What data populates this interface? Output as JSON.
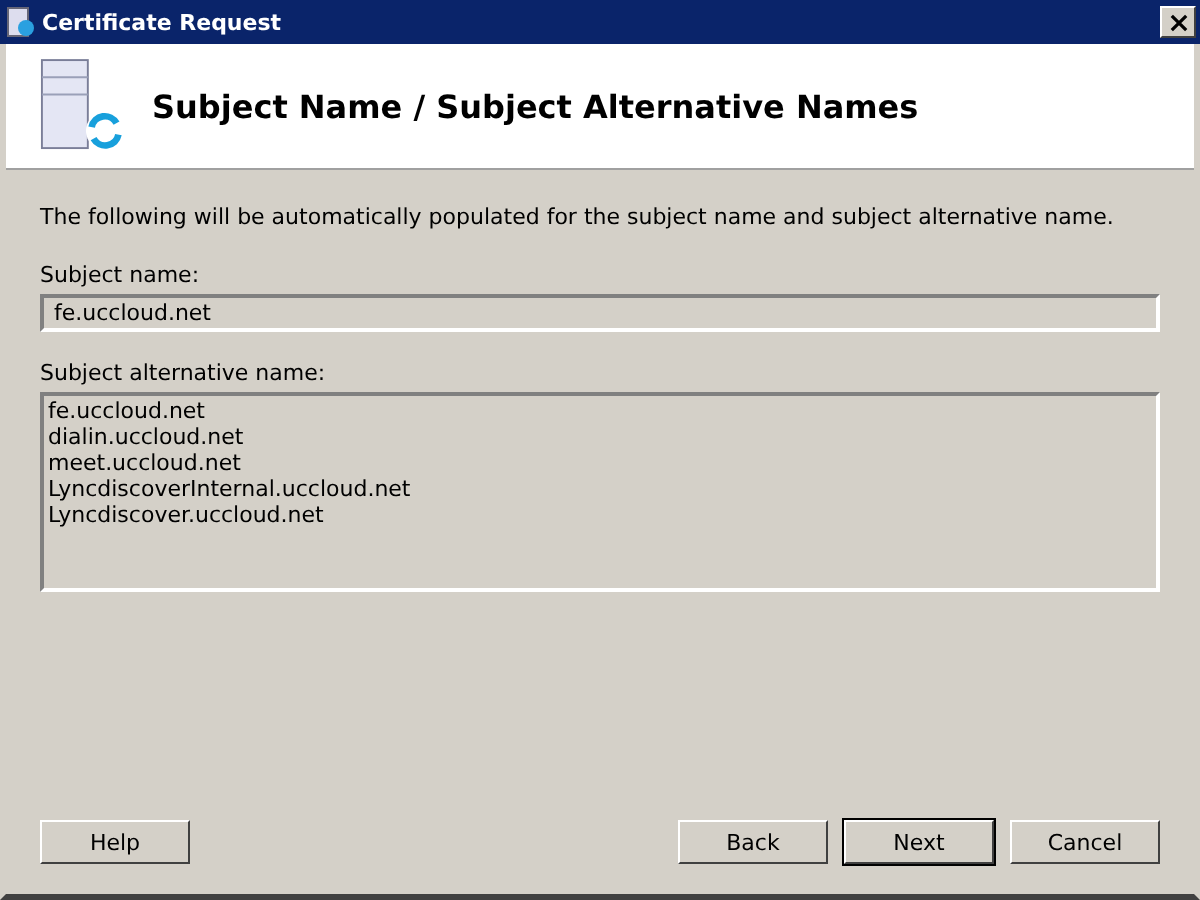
{
  "window": {
    "title": "Certificate Request"
  },
  "header": {
    "title": "Subject Name / Subject Alternative Names"
  },
  "description": "The following will be automatically populated for the subject name and subject alternative name.",
  "subject_name": {
    "label": "Subject name:",
    "value": "fe.uccloud.net"
  },
  "subject_alternative_name": {
    "label": "Subject alternative name:",
    "lines": [
      "fe.uccloud.net",
      "dialin.uccloud.net",
      "meet.uccloud.net",
      "LyncdiscoverInternal.uccloud.net",
      "Lyncdiscover.uccloud.net"
    ]
  },
  "left_buttons": [
    {
      "label": "Help",
      "default": false
    }
  ],
  "right_buttons": [
    {
      "label": "Back",
      "default": false
    },
    {
      "label": "Next",
      "default": true
    },
    {
      "label": "Cancel",
      "default": false
    }
  ]
}
